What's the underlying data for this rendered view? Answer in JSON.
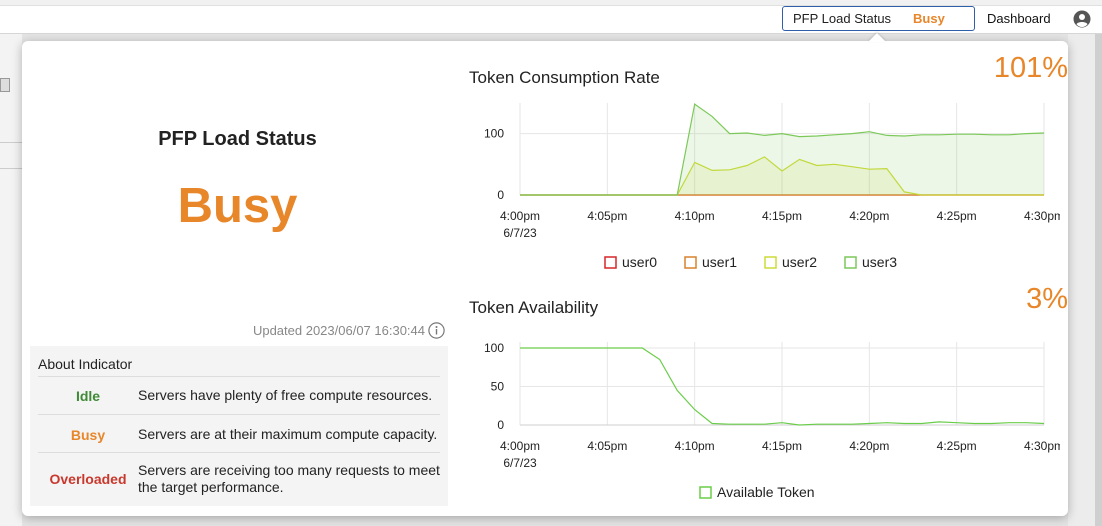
{
  "topbar": {
    "status_label": "PFP Load Status",
    "status_value": "Busy",
    "dashboard_label": "Dashboard"
  },
  "panel": {
    "title": "PFP Load Status",
    "status": "Busy",
    "updated": "Updated 2023/06/07 16:30:44"
  },
  "about": {
    "heading": "About Indicator",
    "items": [
      {
        "name": "Idle",
        "desc_lines": [
          "Servers have plenty of free compute resources."
        ]
      },
      {
        "name": "Busy",
        "desc_lines": [
          "Servers are at their maximum compute capacity."
        ]
      },
      {
        "name": "Overloaded",
        "desc_lines": [
          "Servers are receiving too many requests to meet",
          "the target performance."
        ]
      }
    ]
  },
  "colors": {
    "busy": "#e8862a",
    "idle": "#3f8a36",
    "overloaded": "#c9382d",
    "user0": "#d62728",
    "user1": "#d9822b",
    "user2": "#cddc39",
    "user3": "#7cc95a",
    "available": "#6acd4a"
  },
  "chart_data": [
    {
      "type": "area",
      "title": "Token Consumption Rate",
      "headline_value": "101%",
      "x": [
        "4:00pm",
        "4:01pm",
        "4:02pm",
        "4:03pm",
        "4:04pm",
        "4:05pm",
        "4:06pm",
        "4:07pm",
        "4:08pm",
        "4:09pm",
        "4:10pm",
        "4:11pm",
        "4:12pm",
        "4:13pm",
        "4:14pm",
        "4:15pm",
        "4:16pm",
        "4:17pm",
        "4:18pm",
        "4:19pm",
        "4:20pm",
        "4:21pm",
        "4:22pm",
        "4:23pm",
        "4:24pm",
        "4:25pm",
        "4:26pm",
        "4:27pm",
        "4:28pm",
        "4:29pm",
        "4:30pm"
      ],
      "x_tick_labels": [
        "4:00pm",
        "4:05pm",
        "4:10pm",
        "4:15pm",
        "4:20pm",
        "4:25pm",
        "4:30pm"
      ],
      "x_first_tick_date": "6/7/23",
      "ylim": [
        0,
        140
      ],
      "y_ticks": [
        0,
        100
      ],
      "series": [
        {
          "name": "user0",
          "values": [
            0,
            0,
            0,
            0,
            0,
            0,
            0,
            0,
            0,
            0,
            0,
            0,
            0,
            0,
            0,
            0,
            0,
            0,
            0,
            0,
            0,
            0,
            0,
            0,
            0,
            0,
            0,
            0,
            0,
            0,
            0
          ]
        },
        {
          "name": "user1",
          "values": [
            0,
            0,
            0,
            0,
            0,
            0,
            0,
            0,
            0,
            0,
            0,
            0,
            0,
            0,
            0,
            0,
            0,
            0,
            0,
            0,
            0,
            0,
            0,
            0,
            0,
            0,
            0,
            0,
            0,
            0,
            0
          ]
        },
        {
          "name": "user2",
          "values": [
            0,
            0,
            0,
            0,
            0,
            0,
            0,
            0,
            0,
            0,
            53,
            40,
            41,
            48,
            62,
            39,
            58,
            48,
            50,
            46,
            42,
            43,
            5,
            0,
            0,
            0,
            0,
            0,
            0,
            0,
            0
          ]
        },
        {
          "name": "user3",
          "values": [
            0,
            0,
            0,
            0,
            0,
            0,
            0,
            0,
            0,
            0,
            148,
            128,
            100,
            101,
            97,
            100,
            95,
            96,
            98,
            100,
            103,
            97,
            96,
            98,
            98,
            99,
            99,
            98,
            98,
            100,
            101
          ]
        }
      ],
      "legend": [
        "user0",
        "user1",
        "user2",
        "user3"
      ],
      "legend_position": "bottom"
    },
    {
      "type": "line",
      "title": "Token Availability",
      "headline_value": "3%",
      "x": [
        "4:00pm",
        "4:01pm",
        "4:02pm",
        "4:03pm",
        "4:04pm",
        "4:05pm",
        "4:06pm",
        "4:07pm",
        "4:08pm",
        "4:09pm",
        "4:10pm",
        "4:11pm",
        "4:12pm",
        "4:13pm",
        "4:14pm",
        "4:15pm",
        "4:16pm",
        "4:17pm",
        "4:18pm",
        "4:19pm",
        "4:20pm",
        "4:21pm",
        "4:22pm",
        "4:23pm",
        "4:24pm",
        "4:25pm",
        "4:26pm",
        "4:27pm",
        "4:28pm",
        "4:29pm",
        "4:30pm"
      ],
      "x_tick_labels": [
        "4:00pm",
        "4:05pm",
        "4:10pm",
        "4:15pm",
        "4:20pm",
        "4:25pm",
        "4:30pm"
      ],
      "x_first_tick_date": "6/7/23",
      "ylim": [
        0,
        100
      ],
      "y_ticks": [
        0,
        50,
        100
      ],
      "series": [
        {
          "name": "Available Token",
          "values": [
            100,
            100,
            100,
            100,
            100,
            100,
            100,
            100,
            85,
            45,
            20,
            2,
            1,
            1,
            1,
            3,
            0,
            1,
            1,
            1,
            2,
            3,
            2,
            2,
            4,
            3,
            2,
            2,
            3,
            3,
            2
          ]
        }
      ],
      "legend": [
        "Available Token"
      ],
      "legend_position": "bottom"
    }
  ]
}
